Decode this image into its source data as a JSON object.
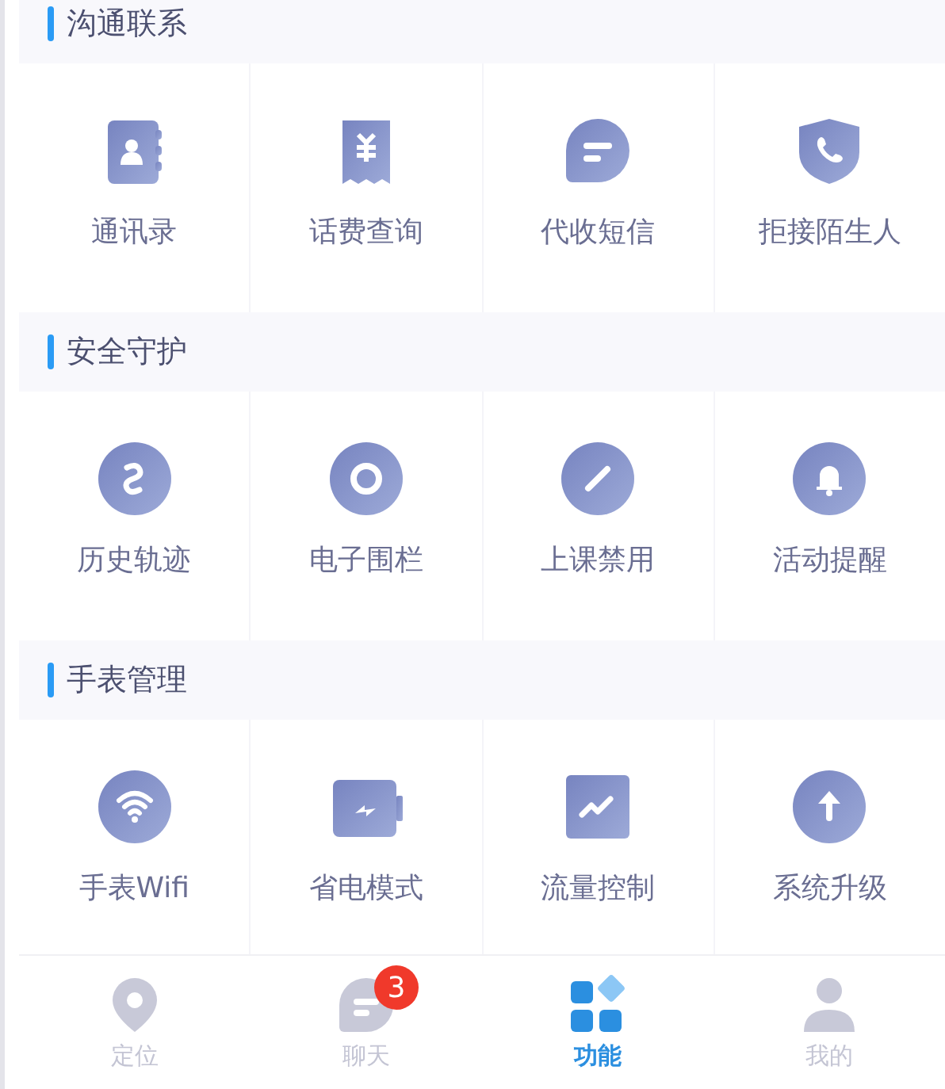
{
  "sections": [
    {
      "title": "沟通联系",
      "items": [
        {
          "label": "通讯录"
        },
        {
          "label": "话费查询"
        },
        {
          "label": "代收短信"
        },
        {
          "label": "拒接陌生人"
        }
      ]
    },
    {
      "title": "安全守护",
      "items": [
        {
          "label": "历史轨迹"
        },
        {
          "label": "电子围栏"
        },
        {
          "label": "上课禁用"
        },
        {
          "label": "活动提醒"
        }
      ]
    },
    {
      "title": "手表管理",
      "items": [
        {
          "label": "手表Wifi"
        },
        {
          "label": "省电模式"
        },
        {
          "label": "流量控制"
        },
        {
          "label": "系统升级"
        }
      ]
    }
  ],
  "tab_bar": [
    {
      "label": "定位",
      "selected": false
    },
    {
      "label": "聊天",
      "selected": false,
      "badge": "3"
    },
    {
      "label": "功能",
      "selected": true
    },
    {
      "label": "我的",
      "selected": false
    }
  ]
}
